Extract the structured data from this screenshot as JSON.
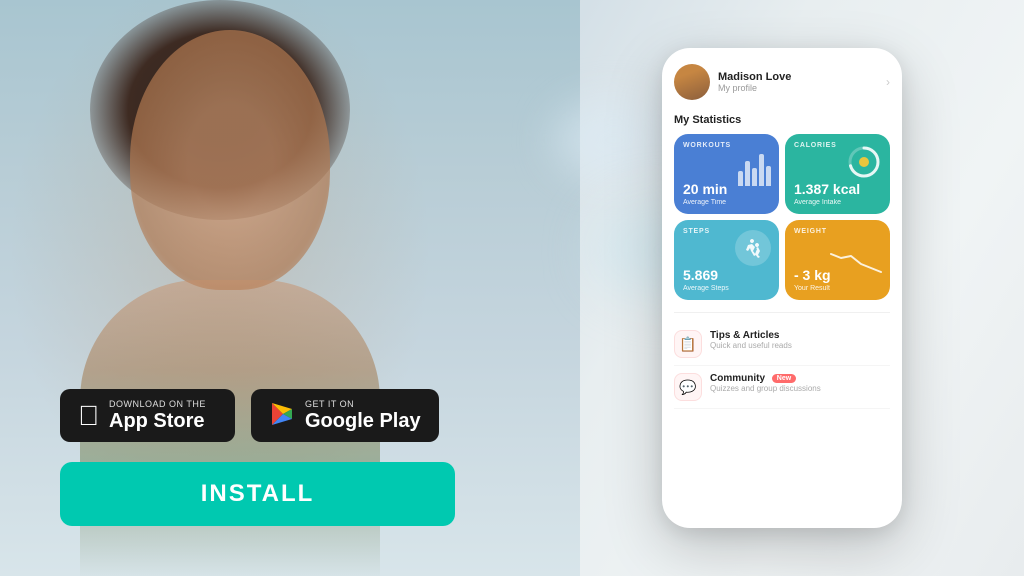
{
  "background": {
    "alt": "Woman with eyes closed in peaceful outdoor setting"
  },
  "app_store": {
    "prefix": "Download on the",
    "name": "App Store",
    "icon": "apple"
  },
  "google_play": {
    "prefix": "GET IT ON",
    "name": "Google Play",
    "icon": "play"
  },
  "install_button": {
    "label": "INSTALL"
  },
  "phone": {
    "profile": {
      "name": "Madison Love",
      "subtitle": "My profile"
    },
    "statistics": {
      "title": "My Statistics",
      "cards": [
        {
          "label": "WORKOUTS",
          "value": "20 min",
          "sub": "Average Time",
          "color": "blue"
        },
        {
          "label": "CALORIES",
          "value": "1.387 kcal",
          "sub": "Average Intake",
          "color": "teal"
        },
        {
          "label": "STEPS",
          "value": "5.869",
          "sub": "Average Steps",
          "color": "cyan"
        },
        {
          "label": "WEIGHT",
          "value": "- 3 kg",
          "sub": "Your Result",
          "color": "orange"
        }
      ]
    },
    "list_items": [
      {
        "icon": "📋",
        "title": "Tips & Articles",
        "subtitle": "Quick and useful reads",
        "badge": null
      },
      {
        "icon": "💬",
        "title": "Community",
        "subtitle": "Quizzes and group discussions",
        "badge": "New"
      }
    ]
  }
}
